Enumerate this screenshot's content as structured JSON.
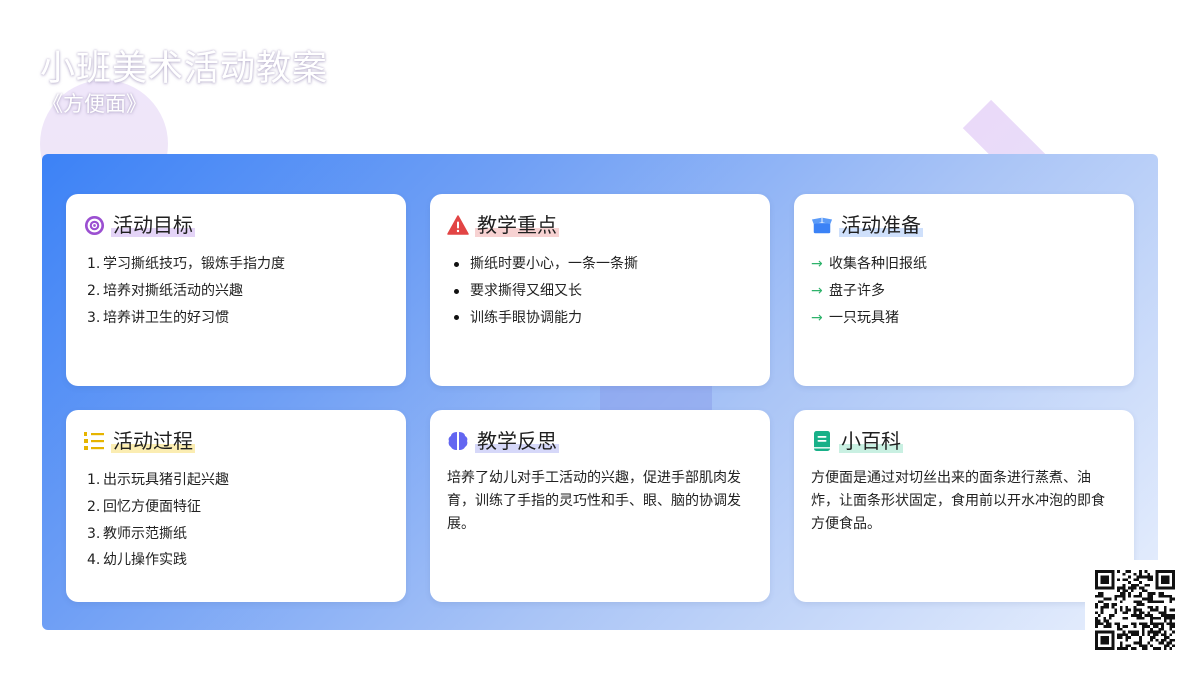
{
  "header": {
    "title": "小班美术活动教案",
    "subtitle": "《方便面》"
  },
  "cards": [
    {
      "title": "活动目标",
      "icon": "target-icon",
      "items": [
        "学习撕纸技巧，锻炼手指力度",
        "培养对撕纸活动的兴趣",
        "培养讲卫生的好习惯"
      ]
    },
    {
      "title": "教学重点",
      "icon": "warning-icon",
      "items": [
        "撕纸时要小心，一条一条撕",
        "要求撕得又细又长",
        "训练手眼协调能力"
      ]
    },
    {
      "title": "活动准备",
      "icon": "box-open-icon",
      "items": [
        "收集各种旧报纸",
        "盘子许多",
        "一只玩具猪"
      ]
    },
    {
      "title": "活动过程",
      "icon": "ordered-list-icon",
      "items": [
        "出示玩具猪引起兴趣",
        "回忆方便面特征",
        "教师示范撕纸",
        "幼儿操作实践"
      ]
    },
    {
      "title": "教学反思",
      "icon": "brain-icon",
      "text": "培养了幼儿对手工活动的兴趣，促进手部肌肉发育，训练了手指的灵巧性和手、眼、脑的协调发展。"
    },
    {
      "title": "小百科",
      "icon": "book-icon",
      "text": "方便面是通过对切丝出来的面条进行蒸煮、油炸，让面条形状固定，食用前以开水冲泡的即食方便食品。"
    }
  ],
  "colors": {
    "panel_start": "#3c82f6",
    "panel_end": "#e9f0fd",
    "target_icon": "#9b4fd1",
    "warning_icon": "#e24444",
    "box_icon": "#3b82f6",
    "list_icon": "#e6b400",
    "brain_icon": "#6366f1",
    "book_icon": "#18b088",
    "arrow": "#2eb36b"
  }
}
